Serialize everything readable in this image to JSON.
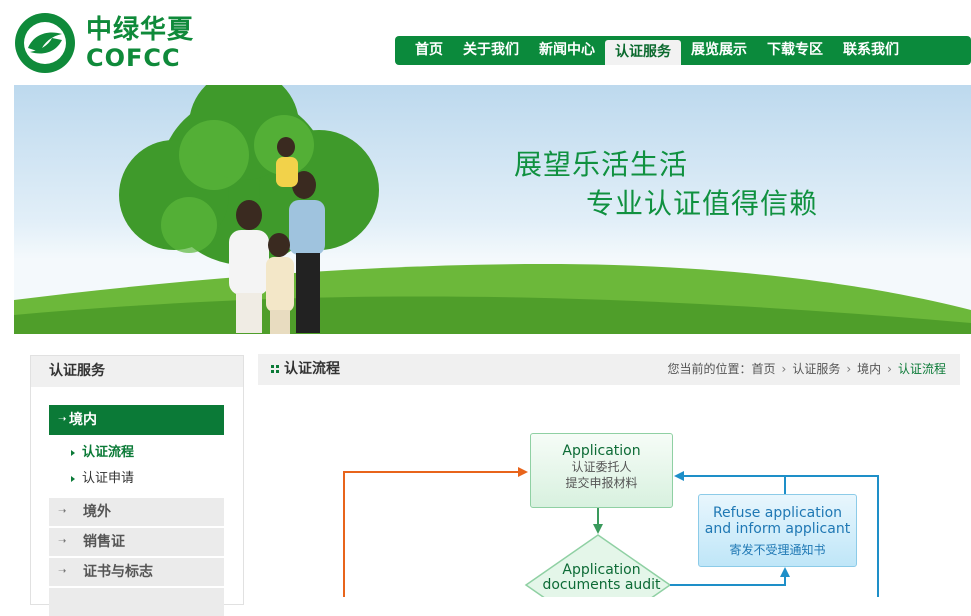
{
  "logo": {
    "cn": "中绿华夏",
    "en": "COFCC"
  },
  "nav": {
    "items": [
      "首页",
      "关于我们",
      "新闻中心",
      "认证服务",
      "展览展示",
      "下载专区",
      "联系我们"
    ],
    "active_index": 3
  },
  "banner": {
    "slogan_line1": "展望乐活生活",
    "slogan_line2": "专业认证值得信赖"
  },
  "sidebar": {
    "title": "认证服务",
    "active_category": "境内",
    "subitems": [
      "认证流程",
      "认证申请"
    ],
    "categories": [
      "境外",
      "销售证",
      "证书与标志"
    ]
  },
  "main": {
    "title": "认证流程",
    "breadcrumb": {
      "prefix": "您当前的位置：",
      "items": [
        "首页",
        "认证服务",
        "境内",
        "认证流程"
      ]
    }
  },
  "flowchart": {
    "application": {
      "en": "Application",
      "cn_line1": "认证委托人",
      "cn_line2": "提交申报材料"
    },
    "refuse": {
      "en_line1": "Refuse application",
      "en_line2": "and inform applicant",
      "cn": "寄发不受理通知书"
    },
    "audit": {
      "en_line1": "Application",
      "en_line2": "documents audit"
    }
  },
  "colors": {
    "brand_green": "#0b8a3c",
    "dark_green": "#0b7a37",
    "orange_line": "#e8641b",
    "blue_line": "#1e8fc8"
  }
}
